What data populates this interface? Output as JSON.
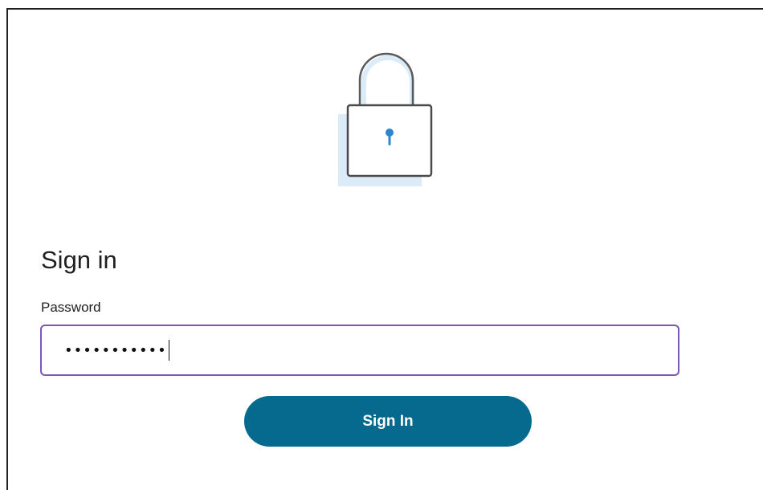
{
  "page": {
    "title": "Sign in"
  },
  "form": {
    "password_label": "Password",
    "password_masked": "•••••••••••",
    "submit_label": "Sign In"
  },
  "icons": {
    "hero": "padlock-icon"
  },
  "colors": {
    "button": "#066a8f",
    "input_focus_border": "#7b57b6",
    "lock_accent": "#2d86c9",
    "lock_shadow": "#dcebf8"
  }
}
